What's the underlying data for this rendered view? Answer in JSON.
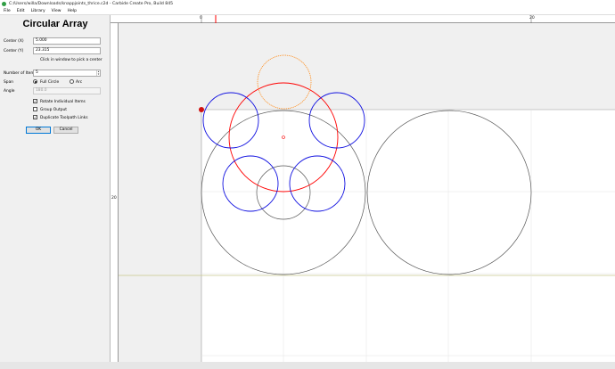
{
  "window": {
    "title": "C:/Users/willa/Downloads/knappjoints_thrice.c2d - Carbide Create Pro, Build 845"
  },
  "menu": [
    "File",
    "Edit",
    "Library",
    "View",
    "Help"
  ],
  "panel": {
    "title": "Circular Array",
    "center_x_label": "Center (X)",
    "center_x_value": "5.000",
    "center_y_label": "Center (Y)",
    "center_y_value": "23.315",
    "pick_hint": "Click in window to pick a center",
    "num_items_label": "Number of Items",
    "num_items_value": "5",
    "span_label": "Span",
    "span_full": "Full Circle",
    "span_arc": "Arc",
    "angle_label": "Angle",
    "angle_value": "180.0",
    "rotate_label": "Rotate Individual Items",
    "rotate_checked": true,
    "group_label": "Group Output",
    "group_checked": false,
    "dup_label": "Duplicate Toolpath Links",
    "dup_checked": true,
    "ok_label": "OK",
    "cancel_label": "Cancel"
  },
  "ruler": {
    "top_labels": [
      "0",
      "20"
    ],
    "left_labels": [
      "20"
    ]
  },
  "colors": {
    "selected": "#ff0000",
    "array_item": "#1010e0",
    "preview": "#ff8c1a",
    "shape": "#555555",
    "stock_edge": "#c8c88c"
  }
}
